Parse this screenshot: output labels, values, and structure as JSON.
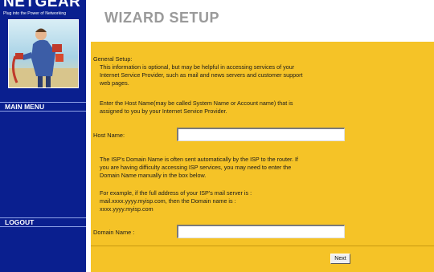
{
  "brand": {
    "logo": "NETGEAR",
    "tagline": "Plug into the Power of Networking"
  },
  "sidebar": {
    "main_menu": "MAIN MENU",
    "logout": "LOGOUT"
  },
  "page_title": "WIZARD SETUP",
  "form": {
    "general_setup_label": "General Setup:",
    "intro_line1": "This information is optional, but may be helpful in accessing services of your",
    "intro_line2": "Internet Service Provider, such as mail and news servers and customer support",
    "intro_line3": "web pages.",
    "host_hint_line1": "Enter the Host Name(may be called System Name or Account name) that is",
    "host_hint_line2": "assigned to you by your Internet Service Provider.",
    "host_name_label": "Host Name:",
    "host_name_value": "",
    "domain_hint_line1": "The ISP's Domain Name is often sent automatically by the ISP to the router. If",
    "domain_hint_line2": "you are having difficulty accessing ISP services, you may need to enter the",
    "domain_hint_line3": "Domain Name manually in the box below.",
    "example_line1": "For example, if the full address of your ISP's mail server is :",
    "example_line2": "mail.xxxx.yyyy.myisp.com, then the Domain name is :",
    "example_line3": "xxxx.yyyy.myisp.com",
    "domain_name_label": "Domain Name :",
    "domain_name_value": "",
    "next_button": "Next"
  },
  "colors": {
    "sidebar": "#0a1f8f",
    "panel": "#f5c327",
    "title": "#9a9a9a"
  }
}
